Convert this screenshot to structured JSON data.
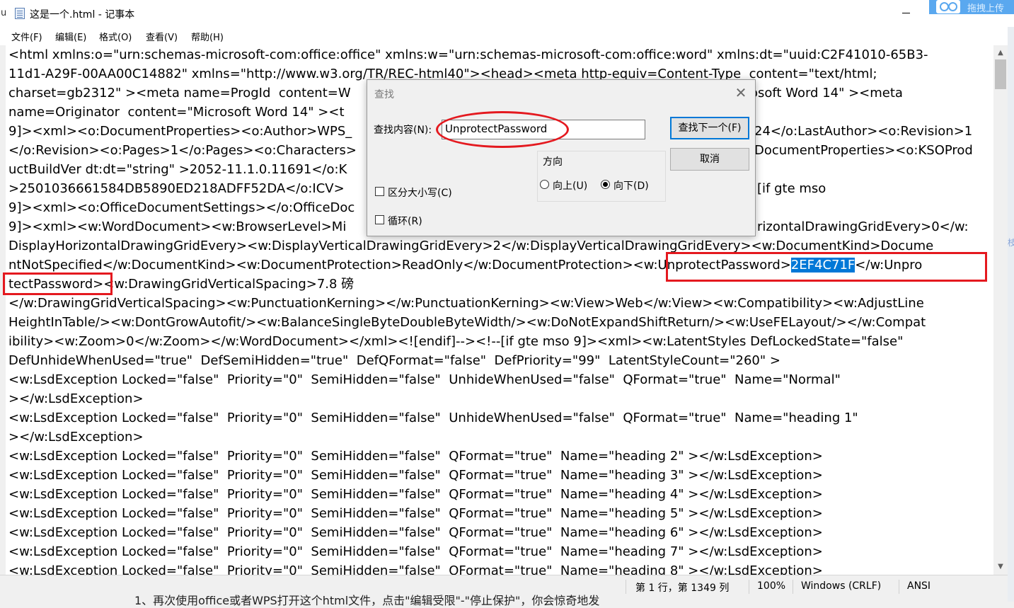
{
  "window": {
    "title": "这是一个.html - 记事本",
    "left_fragment": "u"
  },
  "badge": {
    "label": "拖拽上传"
  },
  "menu": {
    "items": [
      "文件(F)",
      "编辑(E)",
      "格式(O)",
      "查看(V)",
      "帮助(H)"
    ]
  },
  "editor": {
    "lines": [
      "<html xmlns:o=\"urn:schemas-microsoft-com:office:office\" xmlns:w=\"urn:schemas-microsoft-com:office:word\" xmlns:dt=\"uuid:C2F41010-65B3-",
      "11d1-A29F-00AA00C14882\" xmlns=\"http://www.w3.org/TR/REC-html40\"><head><meta http-equiv=Content-Type  content=\"text/html;",
      "charset=gb2312\" ><meta name=ProgId  content=W",
      "name=Originator  content=\"Microsoft Word 14\" ><t",
      "9]><xml><o:DocumentProperties><o:Author>WPS_",
      "</o:Revision><o:Pages>1</o:Pages><o:Characters>",
      "uctBuildVer dt:dt=\"string\" >2052-11.1.0.11691</o:K",
      ">2501036661584DB5890ED218ADFF52DA</o:ICV>",
      "9]><xml><o:OfficeDocumentSettings></o:OfficeDoc",
      "9]><xml><w:WordDocument><w:BrowserLevel>Mi",
      "DisplayHorizontalDrawingGridEvery><w:DisplayVerticalDrawingGridEvery>2</w:DisplayVerticalDrawingGridEvery><w:DocumentKind>Docume",
      "ntNotSpecified</w:DocumentKind><w:DocumentProtection>ReadOnly</w:DocumentProtection><w:UnprotectPassword>",
      "tectPassword><w:DrawingGridVerticalSpacing>7.8 磅",
      "</w:DrawingGridVerticalSpacing><w:PunctuationKerning></w:PunctuationKerning><w:View>Web</w:View><w:Compatibility><w:AdjustLine",
      "HeightInTable/><w:DontGrowAutofit/><w:BalanceSingleByteDoubleByteWidth/><w:DoNotExpandShiftReturn/><w:UseFELayout/></w:Compat",
      "ibility><w:Zoom>0</w:Zoom></w:WordDocument></xml><![endif]--><!--[if gte mso 9]><xml><w:LatentStyles DefLockedState=\"false\"",
      "DefUnhideWhenUsed=\"true\"  DefSemiHidden=\"true\"  DefQFormat=\"false\"  DefPriority=\"99\"  LatentStyleCount=\"260\" >",
      "<w:LsdException Locked=\"false\"  Priority=\"0\"  SemiHidden=\"false\"  UnhideWhenUsed=\"false\"  QFormat=\"true\"  Name=\"Normal\"",
      "></w:LsdException>",
      "<w:LsdException Locked=\"false\"  Priority=\"0\"  SemiHidden=\"false\"  UnhideWhenUsed=\"false\"  QFormat=\"true\"  Name=\"heading 1\"",
      "></w:LsdException>",
      "<w:LsdException Locked=\"false\"  Priority=\"0\"  SemiHidden=\"false\"  QFormat=\"true\"  Name=\"heading 2\" ></w:LsdException>",
      "<w:LsdException Locked=\"false\"  Priority=\"0\"  SemiHidden=\"false\"  QFormat=\"true\"  Name=\"heading 3\" ></w:LsdException>",
      "<w:LsdException Locked=\"false\"  Priority=\"0\"  SemiHidden=\"false\"  QFormat=\"true\"  Name=\"heading 4\" ></w:LsdException>",
      "<w:LsdException Locked=\"false\"  Priority=\"0\"  SemiHidden=\"false\"  QFormat=\"true\"  Name=\"heading 5\" ></w:LsdException>",
      "<w:LsdException Locked=\"false\"  Priority=\"0\"  SemiHidden=\"false\"  QFormat=\"true\"  Name=\"heading 6\" ></w:LsdException>",
      "<w:LsdException Locked=\"false\"  Priority=\"0\"  SemiHidden=\"false\"  QFormat=\"true\"  Name=\"heading 7\" ></w:LsdException>",
      "<w:LsdException Locked=\"false\"  Priority=\"0\"  SemiHidden=\"false\"  QFormat=\"true\"  Name=\"heading 8\" ></w:LsdException>"
    ],
    "right_fragments": [
      "osoft Word 14\" ><meta",
      "24</o:LastAuthor><o:Revision>1",
      "DocumentProperties><o:KSOProd",
      "[if gte mso",
      "rizontalDrawingGridEvery>0</w:"
    ],
    "selected_text": "2EF4C71F",
    "after_selection": "</w:Unpro"
  },
  "find_dialog": {
    "title": "查找",
    "find_label": "查找内容(N):",
    "find_value": "UnprotectPassword",
    "find_next_button": "查找下一个(F)",
    "cancel_button": "取消",
    "direction_title": "方向",
    "direction_up": "向上(U)",
    "direction_down": "向下(D)",
    "direction_selected": "down",
    "match_case": "区分大小写(C)",
    "wrap_around": "循环(R)",
    "match_case_checked": false,
    "wrap_around_checked": false
  },
  "status": {
    "position": "第 1 行，第 1349 列",
    "zoom": "100%",
    "line_ending": "Windows (CRLF)",
    "encoding": "ANSI"
  },
  "background_text": "1、再次使用office或者WPS打开这个html文件，点击\"编辑受限\"-\"停止保护\"，你会惊奇地发",
  "right_edge_glyph": "枝",
  "colors": {
    "annotation_red": "#e4191f",
    "selection_blue": "#0078d7"
  }
}
